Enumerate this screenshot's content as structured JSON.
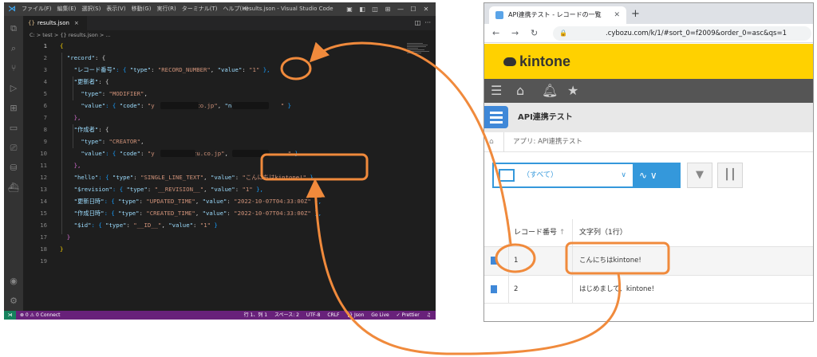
{
  "vscode": {
    "menu": [
      "ファイル(F)",
      "編集(E)",
      "選択(S)",
      "表示(V)",
      "移動(G)",
      "実行(R)",
      "ターミナル(T)",
      "ヘルプ(H)"
    ],
    "window_title": "results.json - Visual Studio Code",
    "tab_label": "results.json",
    "breadcrumb": "C: > test > {} results.json > ...",
    "lines": [
      {
        "n": "1",
        "bracket": "{"
      },
      {
        "n": "2",
        "key": "\"record\"",
        "rest": ": {"
      },
      {
        "n": "3",
        "key": "\"レコード番号\"",
        "mid": ": { ",
        "k1": "\"type\"",
        "c1": ": ",
        "v1": "\"RECORD_NUMBER\"",
        "c2": ", ",
        "k2": "\"value\"",
        "c3": ": ",
        "v2": "\"1\"",
        "end": " },"
      },
      {
        "n": "4",
        "key": "\"更新者\"",
        "rest": ": {"
      },
      {
        "n": "5",
        "key": "\"type\"",
        "c1": ": ",
        "v1": "\"MODIFIER\"",
        "end": ","
      },
      {
        "n": "6",
        "key": "\"value\"",
        "mid": ": { ",
        "k1": "\"code\"",
        "c1": ": ",
        "v1": "\"y          u.co.jp\"",
        "c2": ", ",
        "k2": "\"name\"",
        "c3": ": ",
        "v2": "\"       \"",
        "end": " }"
      },
      {
        "n": "7",
        "bracket": "},"
      },
      {
        "n": "8",
        "key": "\"作成者\"",
        "rest": ": {"
      },
      {
        "n": "9",
        "key": "\"type\"",
        "c1": ": ",
        "v1": "\"CREATOR\"",
        "end": ","
      },
      {
        "n": "10",
        "key": "\"value\"",
        "mid": ": { ",
        "k1": "\"code\"",
        "c1": ": ",
        "v1": "\"y         uazu.co.jp\"",
        "c2": ", ",
        "k2": "\"name\"",
        "c3": ": ",
        "v2": "\"       \"",
        "end": " }"
      },
      {
        "n": "11",
        "bracket": "},"
      },
      {
        "n": "12",
        "key": "\"hello\"",
        "mid": ": { ",
        "k1": "\"type\"",
        "c1": ": ",
        "v1": "\"SINGLE_LINE_TEXT\"",
        "c2": ", ",
        "k2": "\"value\"",
        "c3": ": ",
        "v2": "\"こんにちはkintone!\"",
        "end": " },"
      },
      {
        "n": "13",
        "key": "\"$revision\"",
        "mid": ": { ",
        "k1": "\"type\"",
        "c1": ": ",
        "v1": "\"__REVISION__\"",
        "c2": ", ",
        "k2": "\"value\"",
        "c3": ": ",
        "v2": "\"1\"",
        "end": " },"
      },
      {
        "n": "14",
        "key": "\"更新日時\"",
        "mid": ": { ",
        "k1": "\"type\"",
        "c1": ": ",
        "v1": "\"UPDATED_TIME\"",
        "c2": ", ",
        "k2": "\"value\"",
        "c3": ": ",
        "v2": "\"2022-10-07T04:33:00Z\"",
        "end": " },"
      },
      {
        "n": "15",
        "key": "\"作成日時\"",
        "mid": ": { ",
        "k1": "\"type\"",
        "c1": ": ",
        "v1": "\"CREATED_TIME\"",
        "c2": ", ",
        "k2": "\"value\"",
        "c3": ": ",
        "v2": "\"2022-10-07T04:33:00Z\"",
        "end": " },"
      },
      {
        "n": "16",
        "key": "\"$id\"",
        "mid": ": { ",
        "k1": "\"type\"",
        "c1": ": ",
        "v1": "\"__ID__\"",
        "c2": ", ",
        "k2": "\"value\"",
        "c3": ": ",
        "v2": "\"1\"",
        "end": " }"
      },
      {
        "n": "17",
        "bracket": "}"
      },
      {
        "n": "18",
        "bracket": "}"
      },
      {
        "n": "19"
      }
    ],
    "status": {
      "left": "⊗ 0  ⚠ 0    Connect",
      "position": "行 1、列 1",
      "spaces": "スペース: 2",
      "encoding": "UTF-8",
      "eol": "CRLF",
      "language": "{} Json",
      "golive": "Go Live",
      "prettier": "✓ Prettier"
    }
  },
  "browser": {
    "tab_title": "API連携テスト - レコードの一覧",
    "url": ".cybozu.com/k/1/#sort_0=f2009&order_0=asc&qs=1"
  },
  "kintone": {
    "logo_text": "kintone",
    "app_name": "API連携テスト",
    "breadcrumb": "アプリ: API連携テスト",
    "view_label": "（すべて）",
    "table": {
      "headers": [
        "レコード番号",
        "文字列（1行）"
      ],
      "rows": [
        {
          "num": "1",
          "text": "こんにちはkintone!"
        },
        {
          "num": "2",
          "text": "はじめまして、kintone!"
        }
      ]
    }
  },
  "colors": {
    "highlight": "#f08a3c",
    "kintone_yellow": "#ffd100",
    "kintone_blue": "#3498db"
  }
}
